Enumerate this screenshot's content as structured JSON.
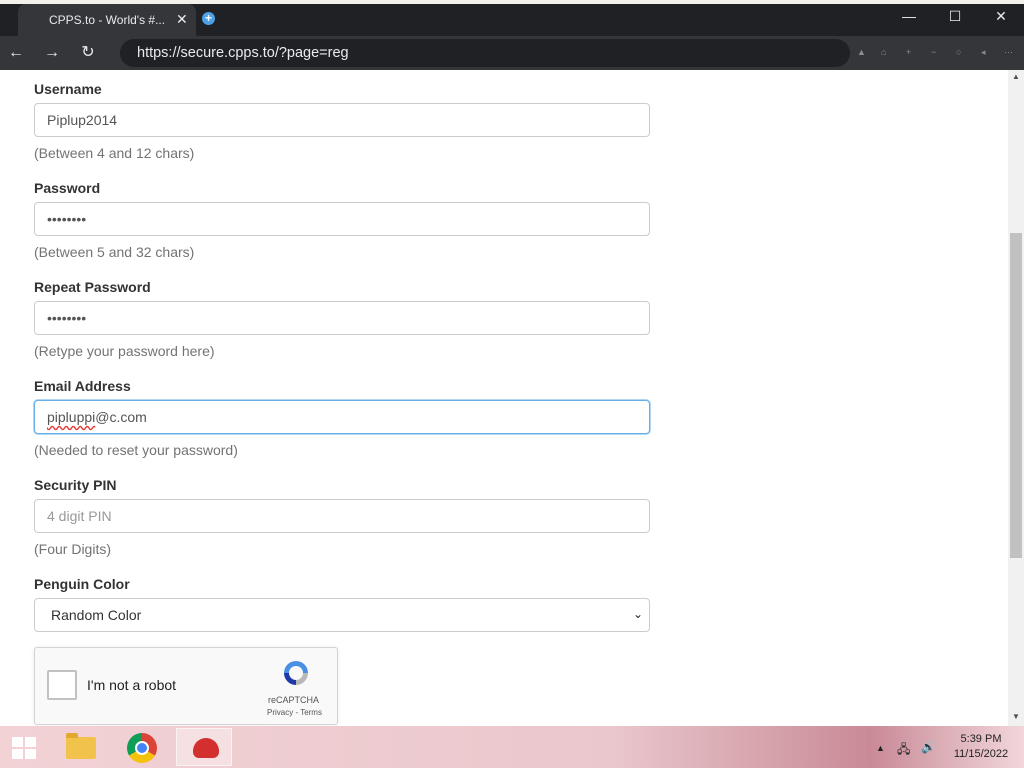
{
  "browser": {
    "tab_title": "CPPS.to - World's #...",
    "tab_close": "✕",
    "new_tab": "+",
    "url": "https://secure.cpps.to/?page=reg",
    "back": "←",
    "forward": "→",
    "reload": "↻",
    "window_controls": {
      "minimize": "—",
      "maximize": "☐",
      "close": "✕"
    }
  },
  "form": {
    "username": {
      "label": "Username",
      "value": "Piplup2014",
      "help": "(Between 4 and 12 chars)"
    },
    "password": {
      "label": "Password",
      "value": "••••••••",
      "help": "(Between 5 and 32 chars)"
    },
    "repeat_password": {
      "label": "Repeat Password",
      "value": "••••••••",
      "help": "(Retype your password here)"
    },
    "email": {
      "label": "Email Address",
      "value_misspelled": "pipluppi",
      "value_rest": "@c.com",
      "help": "(Needed to reset your password)"
    },
    "pin": {
      "label": "Security PIN",
      "placeholder": "4 digit PIN",
      "help": "(Four Digits)"
    },
    "color": {
      "label": "Penguin Color",
      "selected": "Random Color",
      "arrow": "⌄"
    }
  },
  "recaptcha": {
    "label": "I'm not a robot",
    "brand": "reCAPTCHA",
    "links": "Privacy - Terms"
  },
  "taskbar": {
    "time": "5:39 PM",
    "date": "11/15/2022",
    "tray_chevron": "▲",
    "network": "🖧",
    "volume": "🔊"
  }
}
